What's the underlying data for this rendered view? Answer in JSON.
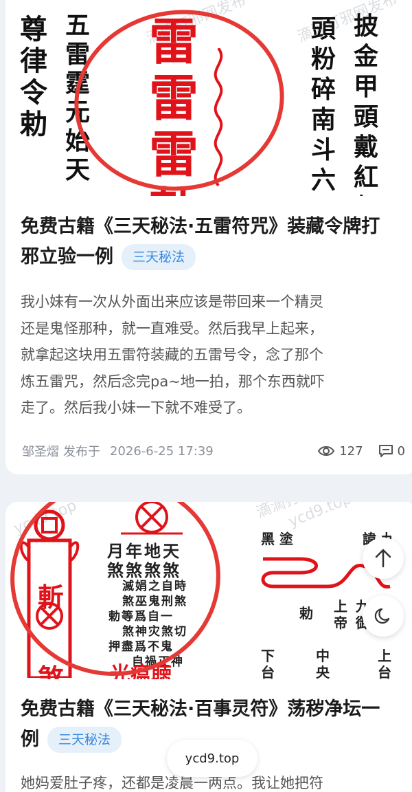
{
  "articles": [
    {
      "title": "免费古籍《三天秘法·五雷符咒》装藏令牌打邪立验一例",
      "title_line1": "免费古籍《三天秘法·五雷符咒》装藏令牌打",
      "title_line2": "邪立验一例",
      "tag": "三天秘法",
      "excerpt": [
        "我小妹有一次从外面出来应该是带回来一个精灵",
        "还是鬼怪那种，就一直难受。然后我早上起来，",
        "就拿起这块用五雷符装藏的五雷号令，念了那个",
        "炼五雷咒，然后念完pa~地一拍，那个东西就吓",
        "走了。然后我小妹一下就不难受了。"
      ],
      "author": "邹圣熠",
      "published_label": "发布于",
      "date": "2026-6-25 17:39",
      "views": "127",
      "comments": "0",
      "thumb": {
        "col_left1": "尊律令勅",
        "col_left2": "五雷霆元始天",
        "big_chars": "雷雷雷勅",
        "col_right1": "頭粉碎南斗六郎",
        "col_right2": "披金甲頭戴紅盔"
      }
    },
    {
      "title": "免费古籍《三天秘法·百事灵符》荡秽净坛一例",
      "title_line1": "免费古籍《三天秘法·百事灵符》荡秽净坛一",
      "title_line2": "例",
      "tag": "三天秘法",
      "excerpt": [
        "她妈爱肚子疼，还都是凌晨一两点。我让她把符"
      ],
      "thumb": {
        "seal_left": "斬煞",
        "row1": "月年地天",
        "row2": "煞煞煞煞",
        "rows": [
          "滅娟之自時",
          "煞巫鬼刑煞",
          "勅等爲自一",
          "煞神灾煞切",
          "押盡爲不鬼",
          "自禍正神"
        ],
        "bottom": "光瘟聴",
        "mid_top": "黑 塗",
        "mid_top2": "諱 九",
        "right_a": "勅",
        "right_b": "上帝",
        "right_c": "九御",
        "right_d": "下台",
        "right_e": "中央",
        "right_f": "上台"
      }
    }
  ],
  "watermark": "滴滴打邪网发布",
  "watermark2": "ycd9.top",
  "floating_site_label": "ycd9.top",
  "icons": {
    "views": "eye-icon",
    "comments": "comment-icon",
    "back_to_top": "arrow-up-icon",
    "theme_toggle": "moon-icon"
  },
  "colors": {
    "accent_red": "#e0131a",
    "tag_bg": "#e6f0fb",
    "tag_fg": "#3a8be0"
  }
}
